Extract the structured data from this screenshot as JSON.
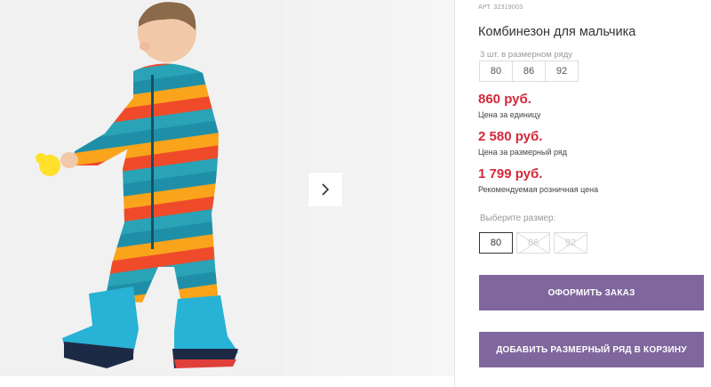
{
  "gallery": {
    "next_arrow_icon": "chevron-right-icon"
  },
  "product": {
    "sku": "АРТ. 32319003",
    "title": "Комбинезон для мальчика",
    "size_row_note": "3 шт. в размерном ряду",
    "size_row": [
      "80",
      "86",
      "92"
    ]
  },
  "prices": {
    "unit_price": "860 руб.",
    "unit_label": "Цена за единицу",
    "row_price": "2 580 руб.",
    "row_label": "Цена за размерный ряд",
    "retail_price": "1 799 руб.",
    "retail_label": "Рекомендуемая розничная цена"
  },
  "size_picker": {
    "label": "Выберите размер:",
    "options": [
      "80",
      "86",
      "92"
    ],
    "selected": "80"
  },
  "buttons": {
    "order": "ОФОРМИТЬ ЗАКАЗ",
    "add_row": "ДОБАВИТЬ РАЗМЕРНЫЙ РЯД В КОРЗИНУ"
  },
  "colors": {
    "price": "#d5283a",
    "button": "#7f669d"
  }
}
